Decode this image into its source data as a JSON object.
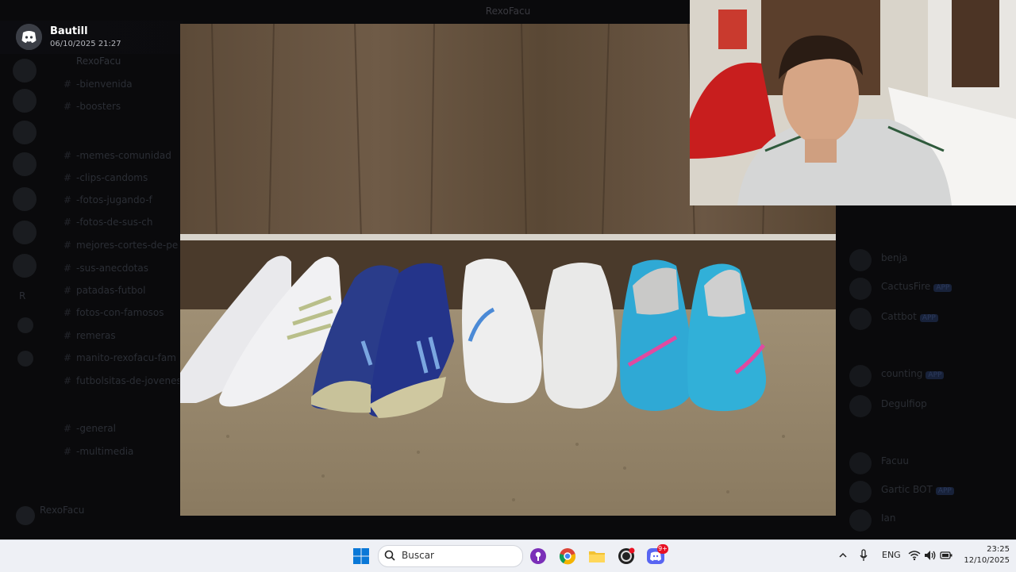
{
  "window": {
    "title": "RexoFacu"
  },
  "viewer": {
    "poster_name": "Bautill",
    "timestamp": "06/10/2025 21:27"
  },
  "server": {
    "name": "RexoFacu",
    "channels": [
      "-bienvenida",
      "-boosters",
      "-memes-comunidad",
      "-clips-candoms",
      "-fotos-jugando-f",
      "-fotos-de-sus-ch",
      "mejores-cortes-de-pe",
      "-sus-anecdotas",
      "patadas-futbol",
      "fotos-con-famosos",
      "remeras",
      "manito-rexofacu-fam",
      "futbolsitas-de-jovenes",
      "-general",
      "-multimedia"
    ],
    "user_panel": {
      "name": "RexoFacu",
      "status": ""
    }
  },
  "members": [
    {
      "name": "benja",
      "tag": ""
    },
    {
      "name": "CactusFire",
      "tag": "APP"
    },
    {
      "name": "Cattbot",
      "tag": "APP"
    },
    {
      "name": "counting",
      "tag": "APP"
    },
    {
      "name": "Degulfiop",
      "tag": ""
    },
    {
      "name": "Facuu",
      "tag": ""
    },
    {
      "name": "Gartic BOT",
      "tag": "APP"
    },
    {
      "name": "Ian",
      "tag": ""
    }
  ],
  "taskbar": {
    "search_placeholder": "Buscar",
    "language": "ENG",
    "time": "23:25",
    "date": "12/10/2025",
    "notification_badge": "9+"
  },
  "colors": {
    "taskbar_bg": "#eef0f5",
    "discord_blurple": "#5865f2",
    "windows_blue": "#0078d4"
  }
}
